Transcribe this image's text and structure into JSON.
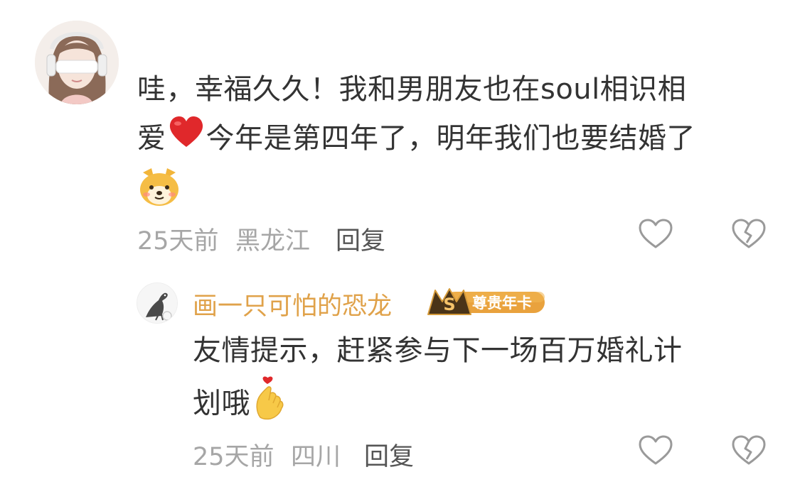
{
  "comment": {
    "text_line1": "哇，幸福久久！我和男朋友也在soul相识相",
    "text_line2_a": "爱",
    "text_line2_b": "今年是第四年了，明年我们也要结婚了",
    "time": "25天前",
    "location": "黑龙江",
    "reply_label": "回复"
  },
  "reply": {
    "username": "画一只可怕的恐龙",
    "vip_badge": "尊贵年卡",
    "vip_letter": "S",
    "text_line1": "友情提示，赶紧参与下一场百万婚礼计",
    "text_line2": "划哦",
    "time": "25天前",
    "location": "四川",
    "reply_label": "回复"
  },
  "colors": {
    "username": "#e0a24a",
    "meta": "#a6a6a6",
    "text": "#333333",
    "heart": "#e0282b",
    "icon_stroke": "#9a9a9a"
  },
  "icons": [
    "heart-emoji",
    "dog-emoji",
    "finger-heart-emoji",
    "like-heart-icon",
    "broken-heart-icon"
  ]
}
